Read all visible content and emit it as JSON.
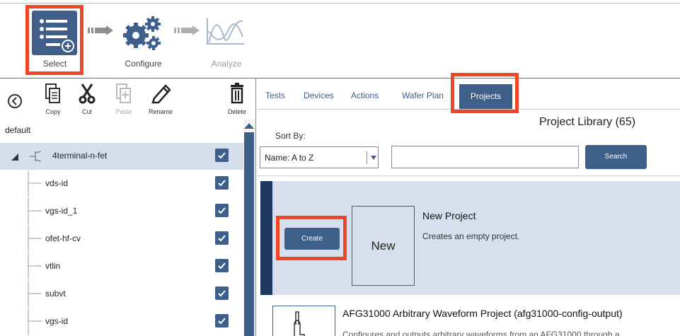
{
  "workflow": {
    "select_label": "Select",
    "configure_label": "Configure",
    "analyze_label": "Analyze"
  },
  "left_toolbar": {
    "copy": "Copy",
    "cut": "Cut",
    "paste": "Paste",
    "rename": "Rename",
    "delete": "Delete"
  },
  "tree": {
    "root_label": "default",
    "project": "4terminal-n-fet",
    "items": [
      "vds-id",
      "vgs-id_1",
      "ofet-hf-cv",
      "vtlin",
      "subvt",
      "vgs-id"
    ]
  },
  "tabs": {
    "tests": "Tests",
    "devices": "Devices",
    "actions": "Actions",
    "wafer_plan": "Wafer Plan",
    "projects": "Projects"
  },
  "library": {
    "title": "Project Library (65)",
    "sort_label": "Sort By:",
    "sort_value": "Name: A to Z",
    "search_value": "",
    "search_button": "Search"
  },
  "new_project": {
    "create_button": "Create",
    "thumb_text": "New",
    "title": "New Project",
    "description": "Creates an empty project."
  },
  "afg_project": {
    "title": "AFG31000 Arbitrary Waveform Project (afg31000-config-output)",
    "description": "Configures and outputs arbitrary waveforms from an AFG31000 through a"
  },
  "colors": {
    "accent": "#3e5f89",
    "highlight": "#ef4626",
    "selected_row": "#d5dfec"
  }
}
